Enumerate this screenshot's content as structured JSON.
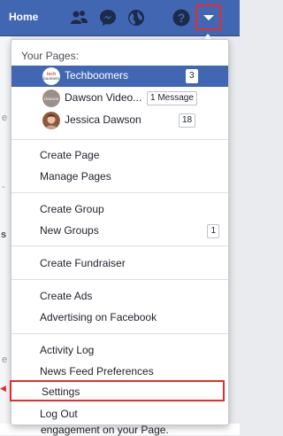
{
  "topbar": {
    "home_label": "Home",
    "icons": [
      "friends-icon",
      "messenger-icon",
      "globe-icon",
      "help-icon",
      "dropdown-arrow-icon"
    ]
  },
  "dropdown": {
    "your_pages_header": "Your Pages:",
    "pages": [
      {
        "name": "Techboomers",
        "badge": "3",
        "avatar": "techboomers-logo"
      },
      {
        "name": "Dawson Video...",
        "badge": "1 Message",
        "avatar": "dawson-video-logo"
      },
      {
        "name": "Jessica Dawson",
        "badge": "18",
        "avatar": "jessica-dawson-photo"
      }
    ],
    "page_actions": [
      "Create Page",
      "Manage Pages"
    ],
    "group_actions": {
      "create": "Create Group",
      "new_groups": "New Groups",
      "new_groups_count": "1"
    },
    "fundraiser": "Create Fundraiser",
    "ads": [
      "Create Ads",
      "Advertising on Facebook"
    ],
    "account": [
      "Activity Log",
      "News Feed Preferences"
    ],
    "settings": "Settings",
    "logout": "Log Out"
  },
  "background": {
    "bottom_text": "engagement on your Page."
  },
  "colors": {
    "brand_blue": "#4267b2",
    "highlight_red": "#e02d2d"
  }
}
